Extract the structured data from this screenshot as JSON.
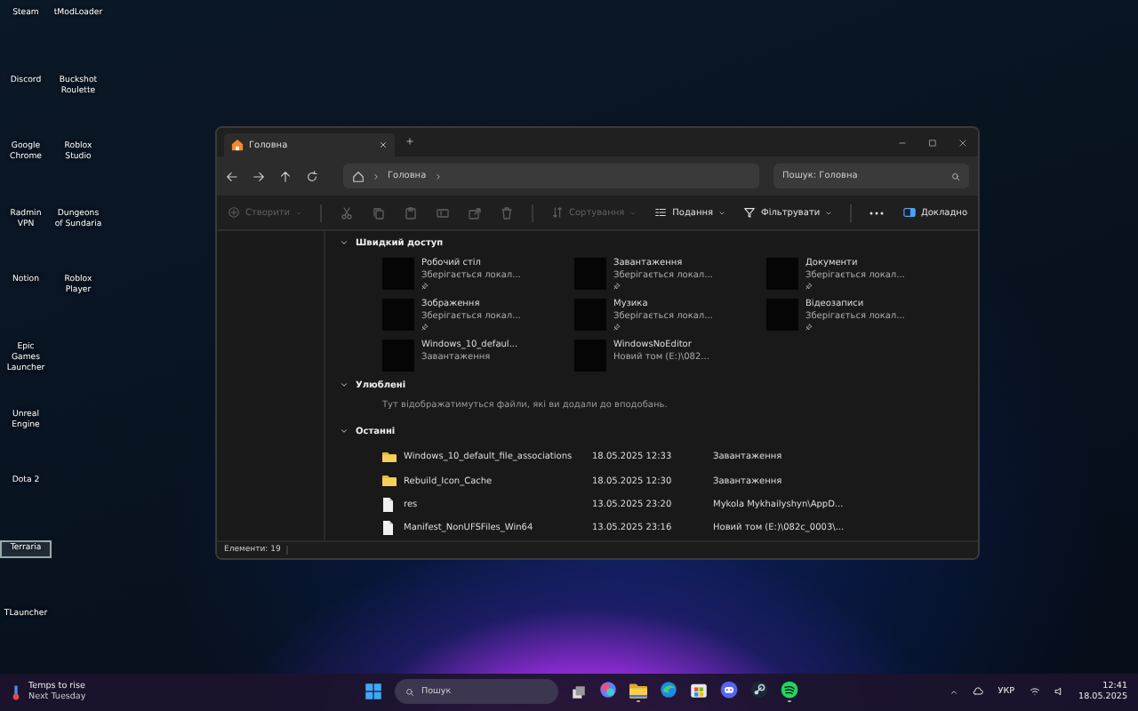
{
  "desktop_icons": [
    {
      "label": "Steam",
      "selected": false
    },
    {
      "label": "Discord",
      "selected": false
    },
    {
      "label": "Google Chrome",
      "selected": false
    },
    {
      "label": "Radmin VPN",
      "selected": false
    },
    {
      "label": "Notion",
      "selected": false
    },
    {
      "label": "Epic Games Launcher",
      "selected": false
    },
    {
      "label": "Unreal Engine",
      "selected": false
    },
    {
      "label": "Dota 2",
      "selected": false
    },
    {
      "label": "Terraria",
      "selected": true
    },
    {
      "label": "TLauncher",
      "selected": false
    },
    {
      "label": "tModLoader",
      "selected": false
    },
    {
      "label": "Buckshot Roulette",
      "selected": false
    },
    {
      "label": "Roblox Studio",
      "selected": false
    },
    {
      "label": "Dungeons of Sundaria",
      "selected": false
    },
    {
      "label": "Roblox Player",
      "selected": false
    }
  ],
  "explorer": {
    "tab": {
      "title": "Головна",
      "selected": true
    },
    "address": {
      "segments": [
        "Головна"
      ]
    },
    "search": {
      "placeholder": "Пошук: Головна"
    },
    "toolbar": [
      {
        "kind": "new",
        "label": "Створити",
        "disabled": true
      },
      {
        "kind": "cut",
        "disabled": true
      },
      {
        "kind": "copy",
        "disabled": true
      },
      {
        "kind": "paste",
        "disabled": true
      },
      {
        "kind": "rename",
        "disabled": true
      },
      {
        "kind": "share",
        "disabled": true
      },
      {
        "kind": "delete",
        "disabled": true
      },
      {
        "kind": "sort",
        "label": "Сортування",
        "disabled": true
      },
      {
        "kind": "view",
        "label": "Подання",
        "disabled": false
      },
      {
        "kind": "filter",
        "label": "Фільтрувати",
        "disabled": false
      },
      {
        "kind": "more",
        "disabled": false
      },
      {
        "kind": "details",
        "label": "Докладно",
        "disabled": false
      }
    ],
    "sections": [
      {
        "kind": "tiles",
        "title": "Швидкий доступ",
        "expanded": true,
        "items": [
          {
            "name": "Робочий стіл",
            "detail": "Зберігається локал...",
            "pinned": true
          },
          {
            "name": "Завантаження",
            "detail": "Зберігається локал...",
            "pinned": true
          },
          {
            "name": "Документи",
            "detail": "Зберігається локал...",
            "pinned": true
          },
          {
            "name": "Зображення",
            "detail": "Зберігається локал...",
            "pinned": true
          },
          {
            "name": "Музика",
            "detail": "Зберігається локал...",
            "pinned": true
          },
          {
            "name": "Відеозаписи",
            "detail": "Зберігається локал...",
            "pinned": true
          },
          {
            "name": "Windows_10_defaul...",
            "detail": "Завантаження",
            "pinned": false
          },
          {
            "name": "WindowsNoEditor",
            "detail": "Новий том (E:)\\082...",
            "pinned": false
          }
        ]
      },
      {
        "kind": "note",
        "title": "Улюблені",
        "expanded": true,
        "text": "Тут відображатимуться файли, які ви додали до вподобань."
      },
      {
        "kind": "list",
        "title": "Останні",
        "expanded": true,
        "rows": [
          {
            "kind": "folder",
            "name": "Windows_10_default_file_associations",
            "date": "18.05.2025 12:33",
            "location": "Завантаження"
          },
          {
            "kind": "folder",
            "name": "Rebuild_Icon_Cache",
            "date": "18.05.2025 12:30",
            "location": "Завантаження"
          },
          {
            "kind": "file",
            "name": "res",
            "date": "13.05.2025 23:20",
            "location": "Mykola Mykhailyshyn\\AppD..."
          },
          {
            "kind": "file",
            "name": "Manifest_NonUFSFiles_Win64",
            "date": "13.05.2025 23:16",
            "location": "Новий том (E:)\\082c_0003\\..."
          }
        ]
      }
    ],
    "status_bar": "Елементи: 19"
  },
  "taskbar": {
    "weather": {
      "headline": "Temps to rise",
      "subline": "Next Tuesday"
    },
    "search": {
      "placeholder": "Пошук"
    },
    "apps": [
      {
        "kind": "assistant",
        "running": false
      },
      {
        "kind": "folder",
        "running": true
      },
      {
        "kind": "browser",
        "running": false
      },
      {
        "kind": "store",
        "running": false
      },
      {
        "kind": "chat",
        "running": false
      },
      {
        "kind": "steam",
        "running": false
      },
      {
        "kind": "music",
        "running": true
      }
    ],
    "language": "УКР",
    "time": "12:41",
    "date": "18.05.2025"
  }
}
